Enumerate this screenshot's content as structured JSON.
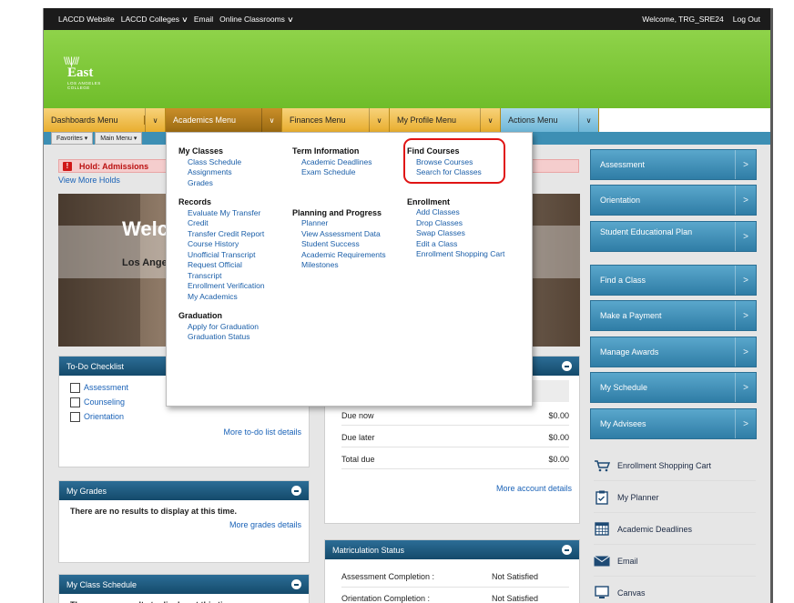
{
  "topbar": {
    "links": [
      "LACCD Website",
      "LACCD Colleges",
      "Email",
      "Online Classrooms"
    ],
    "welcome": "Welcome, TRG_SRE24",
    "logout": "Log Out"
  },
  "logo": {
    "word": "East",
    "sub": "LOS ANGELES COLLEGE"
  },
  "menus": {
    "dashboards": "Dashboards Menu",
    "academics": "Academics Menu",
    "finances": "Finances Menu",
    "profile": "My Profile Menu",
    "actions": "Actions Menu"
  },
  "toolbar": {
    "favorites": "Favorites ▾",
    "main_menu": "Main Menu ▾"
  },
  "hold": {
    "text": "Hold:  Admissions",
    "view_more": "View More Holds"
  },
  "hero": {
    "title": "Welc",
    "subtitle": "Los Angel"
  },
  "todo": {
    "title": "To-Do Checklist",
    "items": [
      "Assessment",
      "Counseling",
      "Orientation"
    ],
    "more": "More to-do list details"
  },
  "grades": {
    "title": "My Grades",
    "message": "There are no results to display at this time.",
    "more": "More grades details"
  },
  "schedule": {
    "title": "My Class Schedule",
    "message": "There are no results to display at this time."
  },
  "account": {
    "rows": [
      {
        "label": "Due now",
        "value": "$0.00"
      },
      {
        "label": "Due later",
        "value": "$0.00"
      },
      {
        "label": "Total due",
        "value": "$0.00"
      }
    ],
    "more": "More account details"
  },
  "matriculation": {
    "title": "Matriculation Status",
    "rows": [
      {
        "label": "Assessment Completion :",
        "value": "Not Satisfied"
      },
      {
        "label": "Orientation Completion :",
        "value": "Not Satisfied"
      }
    ]
  },
  "right_buttons": [
    "Assessment",
    "Orientation",
    "Student Educational Plan",
    "Find a Class",
    "Make a Payment",
    "Manage Awards",
    "My Schedule",
    "My Advisees"
  ],
  "quick_links": [
    "Enrollment Shopping Cart",
    "My Planner",
    "Academic Deadlines",
    "Email",
    "Canvas"
  ],
  "dropdown": {
    "my_classes": {
      "title": "My Classes",
      "links": [
        "Class Schedule",
        "Assignments",
        "Grades"
      ]
    },
    "records": {
      "title": "Records",
      "links": [
        "Evaluate My Transfer",
        "Credit",
        "Transfer Credit Report",
        "Course History",
        "Unofficial Transcript",
        "Request Official",
        "Transcript",
        "Enrollment Verification",
        "My Academics"
      ]
    },
    "graduation": {
      "title": "Graduation",
      "links": [
        "Apply for Graduation",
        "Graduation Status"
      ]
    },
    "term_info": {
      "title": "Term Information",
      "links": [
        "Academic Deadlines",
        "Exam Schedule"
      ]
    },
    "planning": {
      "title": "Planning and Progress",
      "links": [
        "Planner",
        "View Assessment Data",
        "Student Success",
        "Academic Requirements",
        "Milestones"
      ]
    },
    "find_courses": {
      "title": "Find Courses",
      "links": [
        "Browse Courses",
        "Search for Classes"
      ]
    },
    "enrollment": {
      "title": "Enrollment",
      "links": [
        "Add Classes",
        "Drop Classes",
        "Swap Classes",
        "Edit a Class",
        "Enrollment Shopping Cart"
      ]
    }
  }
}
